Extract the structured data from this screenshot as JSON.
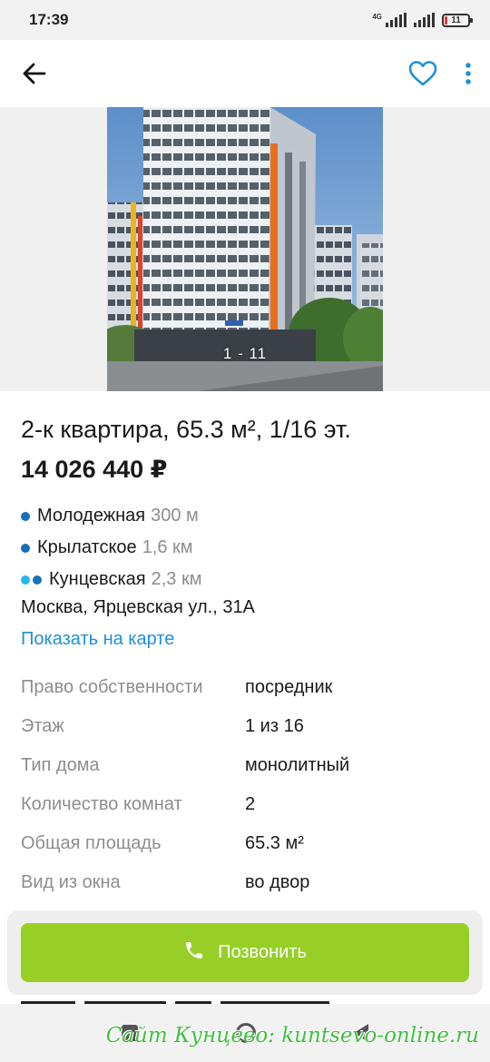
{
  "status_bar": {
    "time": "17:39",
    "network_label": "4G",
    "battery_level": "11",
    "icons": [
      "signal-icon",
      "signal-icon",
      "battery-icon"
    ]
  },
  "app_bar": {
    "back_icon": "arrow-left-icon",
    "favorite_icon": "heart-icon",
    "menu_icon": "more-vertical-icon",
    "accent_color": "#1f8fd6"
  },
  "gallery": {
    "counter": "1 - 11"
  },
  "listing": {
    "title": "2-к квартира, 65.3 м², 1/16 эт.",
    "price": "14 026 440 ₽"
  },
  "metro": [
    {
      "name": "Молодежная",
      "distance": "300 м",
      "line_colors": [
        "#1a6fb5"
      ]
    },
    {
      "name": "Крылатское",
      "distance": "1,6 км",
      "line_colors": [
        "#1a6fb5"
      ]
    },
    {
      "name": "Кунцевская",
      "distance": "2,3 км",
      "line_colors": [
        "#29b6e8",
        "#1a6fb5"
      ]
    }
  ],
  "address": "Москва, Ярцевская ул., 31А",
  "map_link": "Показать на карте",
  "params": [
    {
      "key": "Право собственности",
      "value": "посредник"
    },
    {
      "key": "Этаж",
      "value": "1 из 16"
    },
    {
      "key": "Тип дома",
      "value": "монолитный"
    },
    {
      "key": "Количество комнат",
      "value": "2"
    },
    {
      "key": "Общая площадь",
      "value": "65.3 м²"
    },
    {
      "key": "Вид из окна",
      "value": "во двор"
    }
  ],
  "call_button": {
    "label": "Позвонить",
    "icon": "phone-icon",
    "color": "#97cf26"
  },
  "watermark": "Сайт Кунцево:  kuntsevo-online.ru"
}
